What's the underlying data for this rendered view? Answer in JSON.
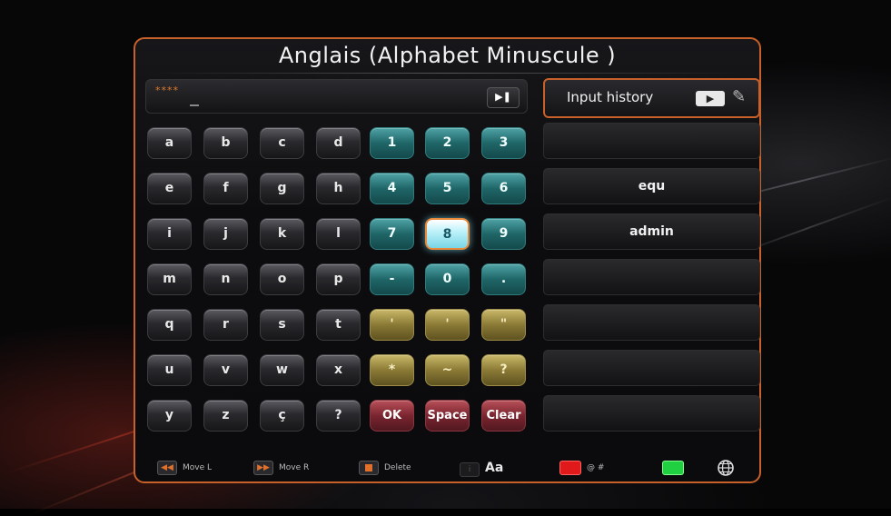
{
  "title": "Anglais (Alphabet Minuscule )",
  "input": {
    "masked_value": "****"
  },
  "history": {
    "header_label": "Input history",
    "items": [
      "",
      "equ",
      "admin",
      "",
      "",
      "",
      ""
    ]
  },
  "keys": {
    "letters": [
      [
        "a",
        "b",
        "c",
        "d"
      ],
      [
        "e",
        "f",
        "g",
        "h"
      ],
      [
        "i",
        "j",
        "k",
        "l"
      ],
      [
        "m",
        "n",
        "o",
        "p"
      ],
      [
        "q",
        "r",
        "s",
        "t"
      ],
      [
        "u",
        "v",
        "w",
        "x"
      ],
      [
        "y",
        "z",
        "ç",
        "?"
      ]
    ],
    "digits": [
      [
        "1",
        "2",
        "3"
      ],
      [
        "4",
        "5",
        "6"
      ],
      [
        "7",
        "8",
        "9"
      ],
      [
        "-",
        "0",
        "."
      ],
      [
        "'",
        "'",
        "\""
      ],
      [
        "*",
        "~",
        "?"
      ]
    ],
    "actions": [
      "OK",
      "Space",
      "Clear"
    ],
    "selected": "8"
  },
  "legend": {
    "move_left": "Move L",
    "move_right": "Move R",
    "delete": "Delete",
    "case": "Aa",
    "red_label": "@ #"
  },
  "colors": {
    "accent_border": "#c8602a",
    "teal_key": "#1f6668",
    "olive_key": "#8a7a36",
    "red_key": "#7a2530",
    "selected_key": "#bff2fa",
    "red_button": "#e01a1a",
    "green_button": "#20d040"
  }
}
